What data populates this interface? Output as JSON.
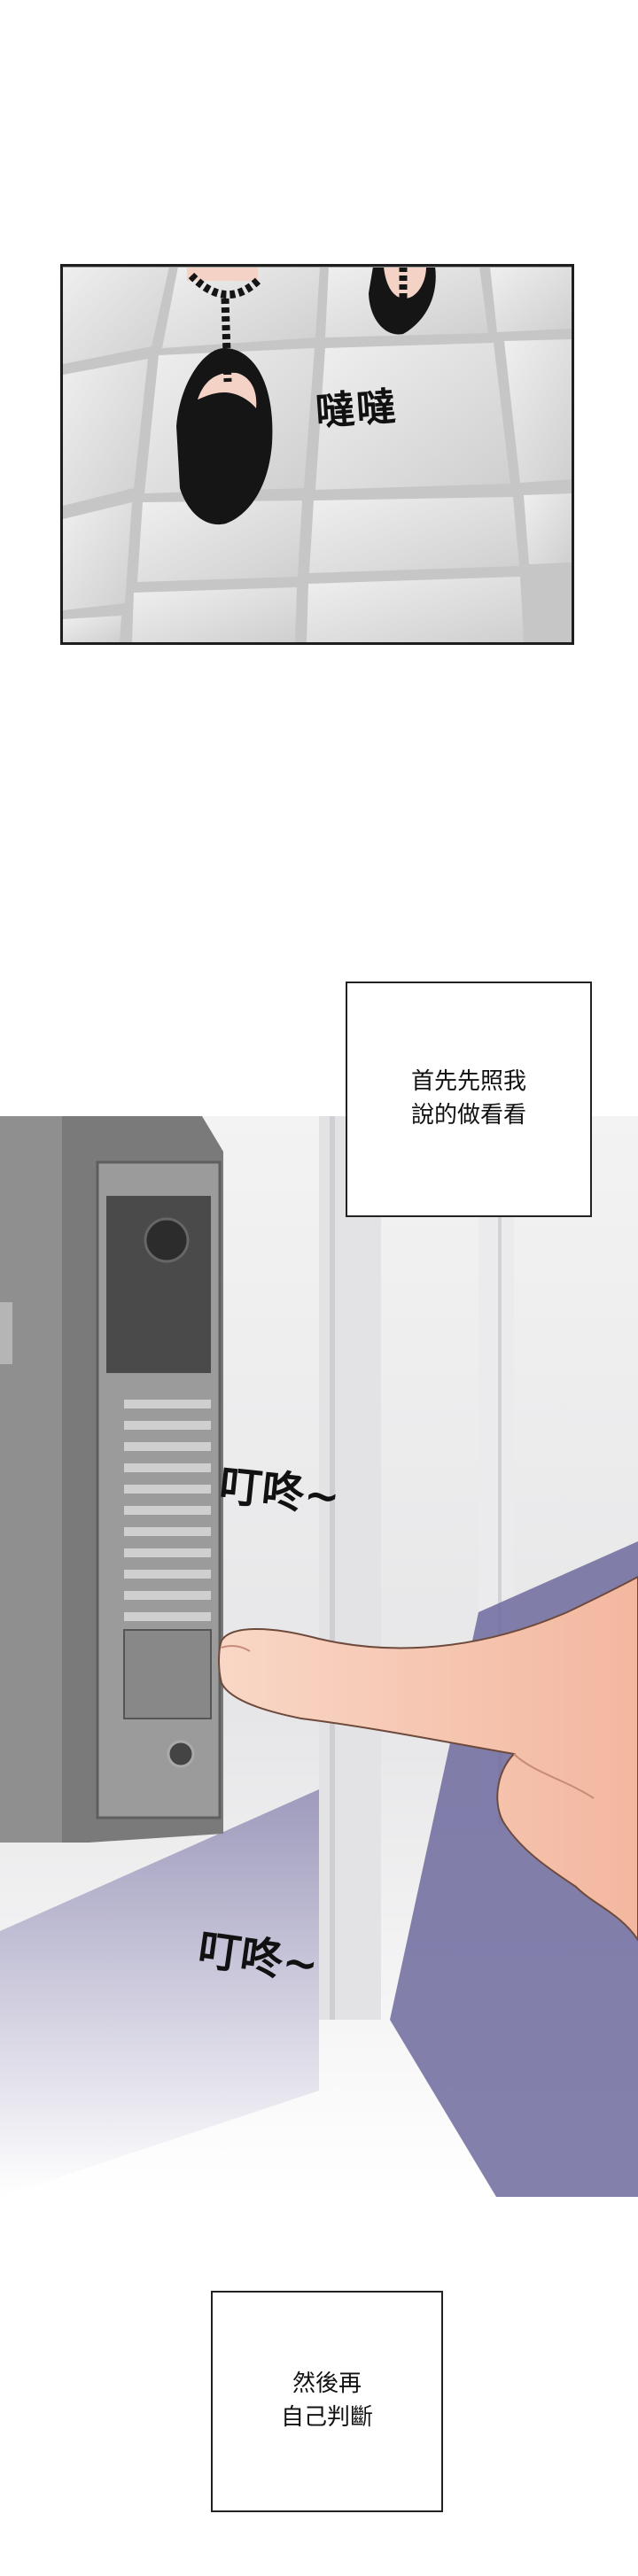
{
  "panel_shoes": {
    "sfx": "噠噠"
  },
  "caption_one": {
    "lines": [
      "首先先照我",
      "說的做看看"
    ]
  },
  "doorbell_scene": {
    "sfx_upper": "叮咚~",
    "sfx_lower": "叮咚~"
  },
  "caption_two": {
    "lines": [
      "然後再",
      "自己判斷"
    ]
  },
  "colors": {
    "floor_tile": "#d9d9d9",
    "shoe": "#111111",
    "skin": "#f7c9b5",
    "wall_shadow": "#6d6a9a"
  }
}
